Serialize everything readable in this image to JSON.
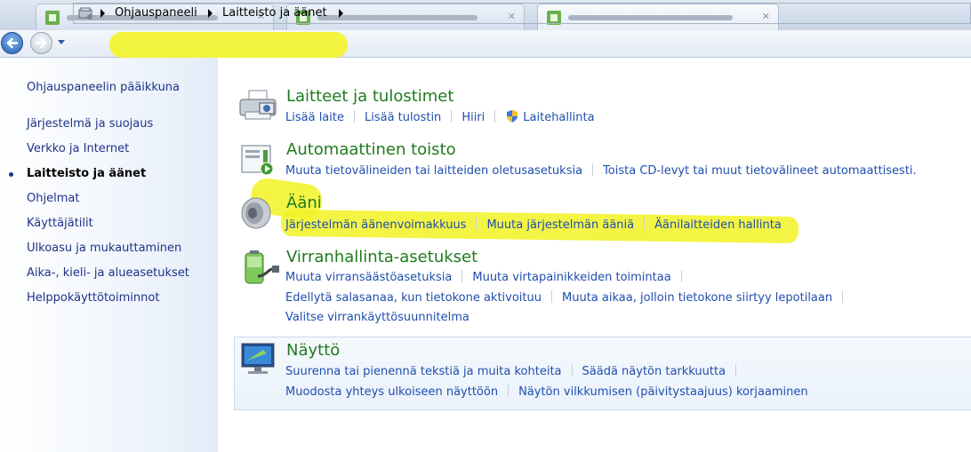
{
  "breadcrumb": {
    "items": [
      "Ohjauspaneeli",
      "Laitteisto ja äänet"
    ]
  },
  "sidebar": {
    "home_label": "Ohjauspaneelin pääikkuna",
    "items": [
      {
        "label": "Järjestelmä ja suojaus",
        "active": false
      },
      {
        "label": "Verkko ja Internet",
        "active": false
      },
      {
        "label": "Laitteisto ja äänet",
        "active": true
      },
      {
        "label": "Ohjelmat",
        "active": false
      },
      {
        "label": "Käyttäjätilit",
        "active": false
      },
      {
        "label": "Ulkoasu ja mukauttaminen",
        "active": false
      },
      {
        "label": "Aika-, kieli- ja alueasetukset",
        "active": false
      },
      {
        "label": "Helppokäyttötoiminnot",
        "active": false
      }
    ]
  },
  "categories": [
    {
      "title": "Laitteet ja tulostimet",
      "icon": "printer-icon",
      "rows": [
        [
          "Lisää laite",
          "Lisää tulostin",
          "Hiiri",
          "Laitehallinta"
        ]
      ]
    },
    {
      "title": "Automaattinen toisto",
      "icon": "autoplay-icon",
      "rows": [
        [
          "Muuta tietovälineiden tai laitteiden oletusasetuksia",
          "Toista CD-levyt tai muut tietovälineet automaattisesti."
        ]
      ]
    },
    {
      "title": "Ääni",
      "icon": "speaker-icon",
      "rows": [
        [
          "Järjestelmän äänenvoimakkuus",
          "Muuta järjestelmän ääniä",
          "Äänilaitteiden hallinta"
        ]
      ]
    },
    {
      "title": "Virranhallinta-asetukset",
      "icon": "battery-icon",
      "rows": [
        [
          "Muuta virransäästöasetuksia",
          "Muuta virtapainikkeiden toimintaa"
        ],
        [
          "Edellytä salasanaa, kun tietokone aktivoituu",
          "Muuta aikaa, jolloin tietokone siirtyy lepotilaan"
        ],
        [
          "Valitse virrankäyttösuunnitelma"
        ]
      ]
    },
    {
      "title": "Näyttö",
      "icon": "monitor-icon",
      "rows": [
        [
          "Suurenna tai pienennä tekstiä ja muita kohteita",
          "Säädä näytön tarkkuutta"
        ],
        [
          "Muodosta yhteys ulkoiseen näyttöön",
          "Näytön vilkkumisen (päivitystaajuus) korjaaminen"
        ]
      ]
    }
  ],
  "colors": {
    "title_green": "#1e7b1e",
    "link_blue": "#1f4eae",
    "sidebar_text": "#1e3287",
    "highlight": "#f3f32a"
  }
}
